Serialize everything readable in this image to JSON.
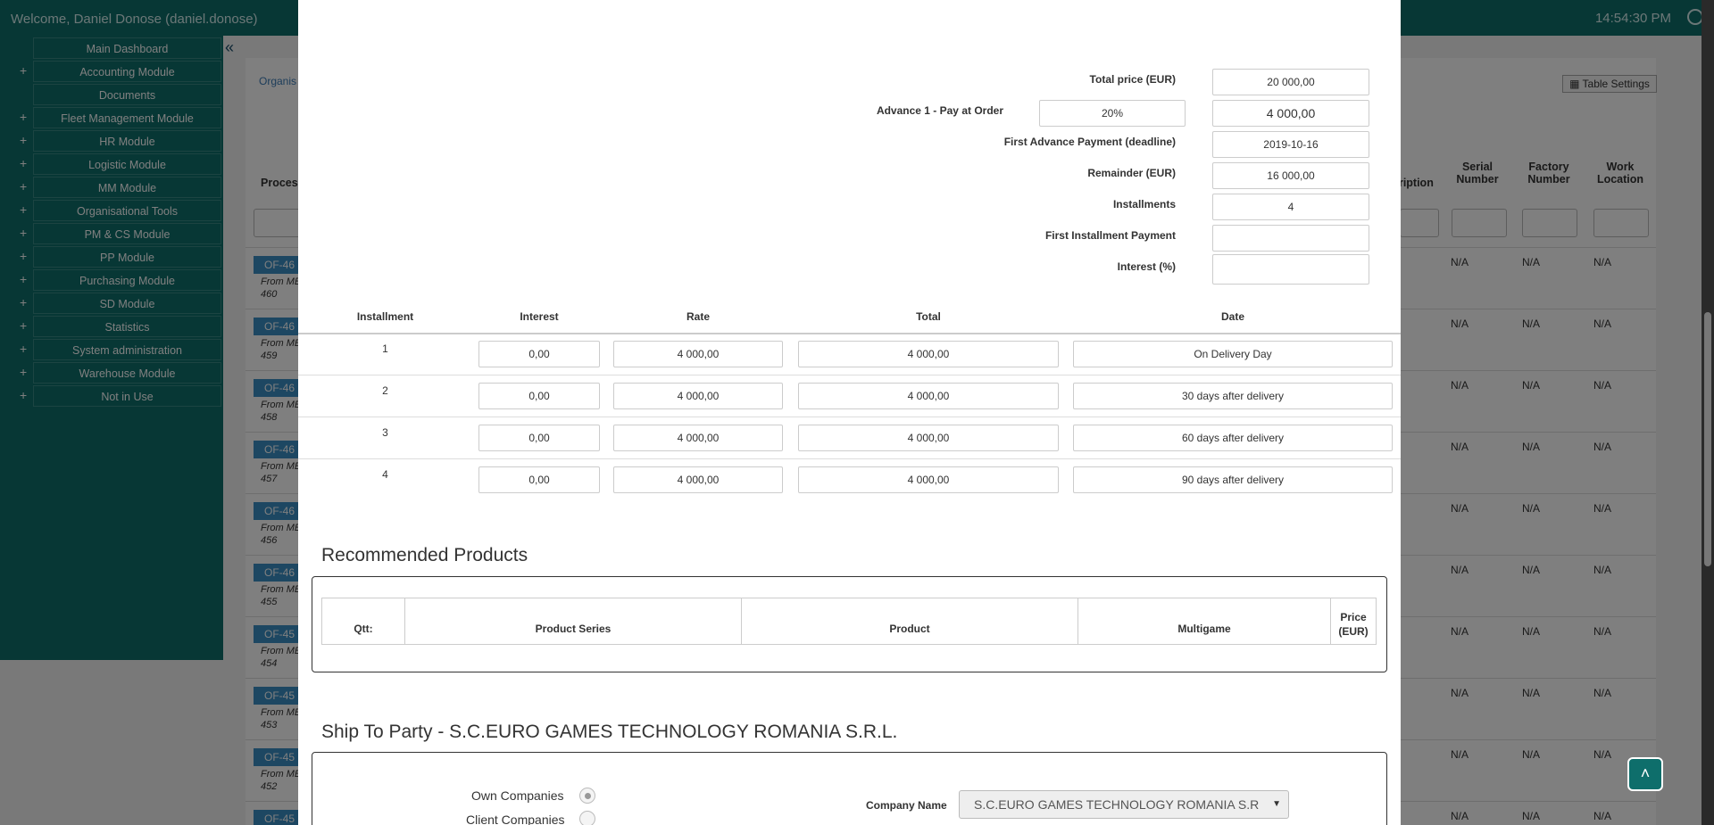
{
  "header": {
    "welcome": "Welcome, Daniel Donose (daniel.donose)",
    "clock": "14:54:30 PM"
  },
  "sidebar": {
    "items": [
      {
        "label": "Main Dashboard",
        "plus": ""
      },
      {
        "label": "Accounting Module",
        "plus": "+"
      },
      {
        "label": "Documents",
        "plus": ""
      },
      {
        "label": "Fleet Management Module",
        "plus": "+"
      },
      {
        "label": "HR Module",
        "plus": "+"
      },
      {
        "label": "Logistic Module",
        "plus": "+"
      },
      {
        "label": "MM Module",
        "plus": "+"
      },
      {
        "label": "Organisational Tools",
        "plus": "+"
      },
      {
        "label": "PM & CS Module",
        "plus": "+"
      },
      {
        "label": "PP Module",
        "plus": "+"
      },
      {
        "label": "Purchasing Module",
        "plus": "+"
      },
      {
        "label": "SD Module",
        "plus": "+"
      },
      {
        "label": "Statistics",
        "plus": "+"
      },
      {
        "label": "System administration",
        "plus": "+"
      },
      {
        "label": "Warehouse Module",
        "plus": "+"
      },
      {
        "label": "Not in Use",
        "plus": "+"
      }
    ]
  },
  "background": {
    "breadcrumb": "Organis",
    "table_settings": "Table Settings",
    "columns": {
      "process": "Proces",
      "description": "cription",
      "serial": "Serial Number",
      "factory": "Factory Number",
      "work": "Work Location"
    },
    "rows": [
      {
        "of": "OF-46",
        "from": "From ME",
        "num": "460"
      },
      {
        "of": "OF-46",
        "from": "From ME",
        "num": "459"
      },
      {
        "of": "OF-46",
        "from": "From ME",
        "num": "458"
      },
      {
        "of": "OF-46",
        "from": "From ME",
        "num": "457"
      },
      {
        "of": "OF-46",
        "from": "From ME",
        "num": "456"
      },
      {
        "of": "OF-46",
        "from": "From ME",
        "num": "455"
      },
      {
        "of": "OF-45",
        "from": "From ME",
        "num": "454"
      },
      {
        "of": "OF-45",
        "from": "From ME",
        "num": "453"
      },
      {
        "of": "OF-45",
        "from": "From ME",
        "num": "452"
      },
      {
        "of": "OF-45",
        "from": "",
        "num": ""
      }
    ],
    "na": "N/A"
  },
  "pricing": {
    "total_price_label": "Total price (EUR)",
    "total_price": "20 000,00",
    "advance_label": "Advance 1 - Pay at Order",
    "advance_percent": "20%",
    "advance_value": "4 000,00",
    "first_advance_label": "First Advance Payment (deadline)",
    "first_advance_date": "2019-10-16",
    "remainder_label": "Remainder (EUR)",
    "remainder": "16 000,00",
    "installments_label": "Installments",
    "installments": "4",
    "first_installment_label": "First Installment Payment",
    "first_installment": "",
    "interest_label": "Interest (%)",
    "interest": ""
  },
  "installments_table": {
    "headers": {
      "installment": "Installment",
      "interest": "Interest",
      "rate": "Rate",
      "total": "Total",
      "date": "Date"
    },
    "rows": [
      {
        "num": "1",
        "interest": "0,00",
        "rate": "4 000,00",
        "total": "4 000,00",
        "date": "On Delivery Day"
      },
      {
        "num": "2",
        "interest": "0,00",
        "rate": "4 000,00",
        "total": "4 000,00",
        "date": "30 days after delivery"
      },
      {
        "num": "3",
        "interest": "0,00",
        "rate": "4 000,00",
        "total": "4 000,00",
        "date": "60 days after delivery"
      },
      {
        "num": "4",
        "interest": "0,00",
        "rate": "4 000,00",
        "total": "4 000,00",
        "date": "90 days after delivery"
      }
    ]
  },
  "recommended": {
    "title": "Recommended Products",
    "headers": {
      "qty": "Qtt:",
      "series": "Product Series",
      "product": "Product",
      "multigame": "Multigame",
      "price": "Price (EUR)"
    }
  },
  "ship": {
    "title": "Ship To Party - S.C.EURO GAMES TECHNOLOGY ROMANIA S.R.L.",
    "own_companies": "Own Companies",
    "client_companies": "Client Companies",
    "company_name_label": "Company Name",
    "company_name_value": "S.C.EURO GAMES TECHNOLOGY ROMANIA S.R"
  }
}
